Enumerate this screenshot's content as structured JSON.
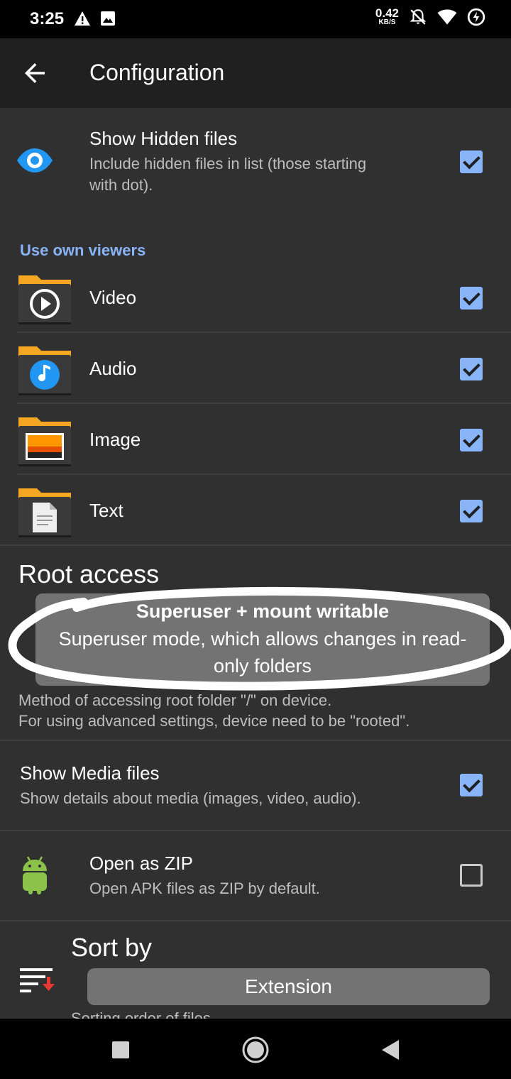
{
  "status_bar": {
    "time": "3:25",
    "net_speed_value": "0.42",
    "net_speed_unit": "KB/S",
    "icons": [
      "warning-icon",
      "image-icon",
      "notifications-off-icon",
      "wifi-icon",
      "data-saver-icon"
    ]
  },
  "app_bar": {
    "title": "Configuration",
    "back_icon": "arrow-back-icon"
  },
  "settings": {
    "hidden_files": {
      "title": "Show Hidden files",
      "summary_line1": "Include hidden files in list (those starting",
      "summary_line2": "with dot).",
      "checked": true,
      "icon": "eye-icon"
    },
    "viewers": {
      "section_label": "Use own viewers",
      "items": [
        {
          "label": "Video",
          "checked": true,
          "icon": "video-folder-icon"
        },
        {
          "label": "Audio",
          "checked": true,
          "icon": "audio-folder-icon"
        },
        {
          "label": "Image",
          "checked": true,
          "icon": "image-folder-icon"
        },
        {
          "label": "Text",
          "checked": true,
          "icon": "text-folder-icon"
        }
      ]
    },
    "root_access": {
      "title": "Root access",
      "selected_title": "Superuser + mount writable",
      "selected_desc": "Superuser mode, which allows changes in read-only folders",
      "summary_line1": "Method of accessing root folder \"/\" on device.",
      "summary_line2": "For using advanced settings, device need to be \"rooted\"."
    },
    "media_files": {
      "title": "Show Media files",
      "summary": "Show details about media (images, video, audio).",
      "checked": true
    },
    "open_zip": {
      "title": "Open as ZIP",
      "summary": "Open APK files as ZIP by default.",
      "checked": false,
      "icon": "android-icon"
    },
    "sort_by": {
      "title": "Sort by",
      "value": "Extension",
      "summary": "Sorting order of files",
      "icon": "sort-icon"
    }
  },
  "nav_bar": {
    "icons": [
      "recents-square-icon",
      "home-circle-icon",
      "back-triangle-icon"
    ]
  },
  "colors": {
    "accent": "#8ab4f8",
    "background": "#303030",
    "app_bar": "#202020",
    "folder": "#f5a623",
    "eye_icon": "#2196f3",
    "android_green": "#8bc34a",
    "sort_arrow": "#e53935"
  }
}
